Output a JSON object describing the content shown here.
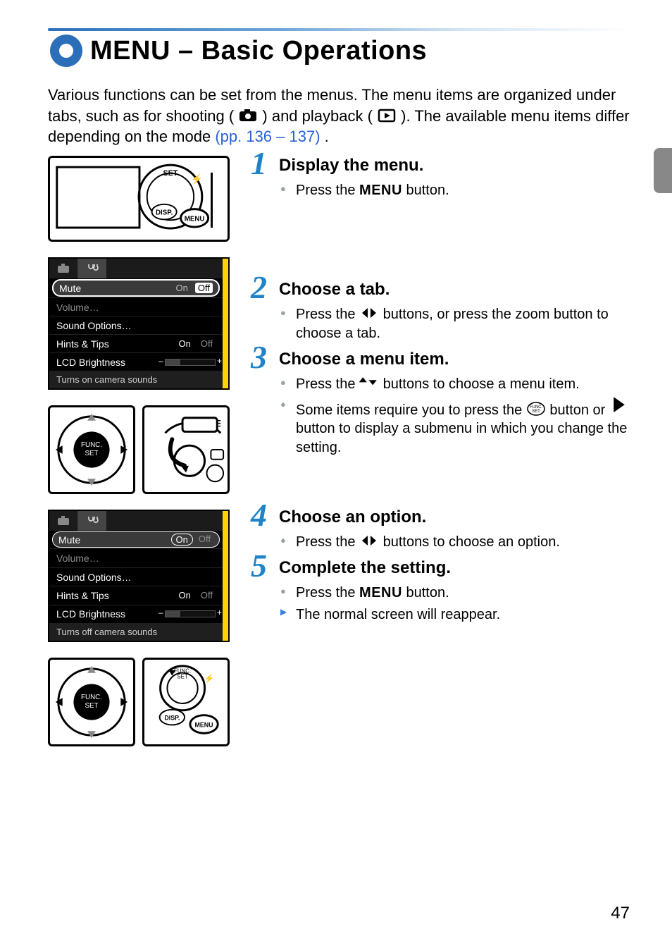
{
  "title": "MENU – Basic Operations",
  "intro": {
    "p1a": "Various functions can be set from the menus. The menu items are organized under tabs, such as for shooting (",
    "p1b": ") and playback (",
    "p1c": "). The available menu items differ depending on the mode ",
    "link": "(pp. 136 – 137)",
    "p1d": "."
  },
  "lcd1": {
    "rows": {
      "mute": "Mute",
      "volume": "Volume…",
      "sound": "Sound Options…",
      "hints": "Hints & Tips",
      "bright": "LCD Brightness"
    },
    "opt_on": "On",
    "opt_off": "Off",
    "desc": "Turns on camera sounds"
  },
  "lcd2": {
    "desc": "Turns off camera sounds"
  },
  "steps": [
    {
      "num": "1",
      "title": "Display the menu.",
      "bullets": [
        {
          "pre": "Press the ",
          "mid": "MENU",
          "post": " button.",
          "type": "circle"
        }
      ]
    },
    {
      "num": "2",
      "title": "Choose a tab.",
      "bullets": [
        {
          "pre": "Press the ",
          "icon": "lr",
          "post": " buttons, or press the zoom button to choose a tab.",
          "type": "circle"
        }
      ]
    },
    {
      "num": "3",
      "title": "Choose a menu item.",
      "bullets": [
        {
          "pre": "Press the ",
          "icon": "ud",
          "post": " buttons to choose a menu item.",
          "type": "circle"
        },
        {
          "pre": "Some items require you to press the ",
          "icon": "funcset",
          "post2_pre": " button or ",
          "icon2": "r",
          "post": " button to display a submenu in which you change the setting.",
          "type": "circle"
        }
      ]
    },
    {
      "num": "4",
      "title": "Choose an option.",
      "bullets": [
        {
          "pre": "Press the ",
          "icon": "lr",
          "post": " buttons to choose an option.",
          "type": "circle"
        }
      ]
    },
    {
      "num": "5",
      "title": "Complete the setting.",
      "bullets": [
        {
          "pre": "Press the ",
          "mid": "MENU",
          "post": " button.",
          "type": "circle"
        },
        {
          "pre": "The normal screen will reappear.",
          "type": "tri"
        }
      ]
    }
  ],
  "pageNumber": "47"
}
